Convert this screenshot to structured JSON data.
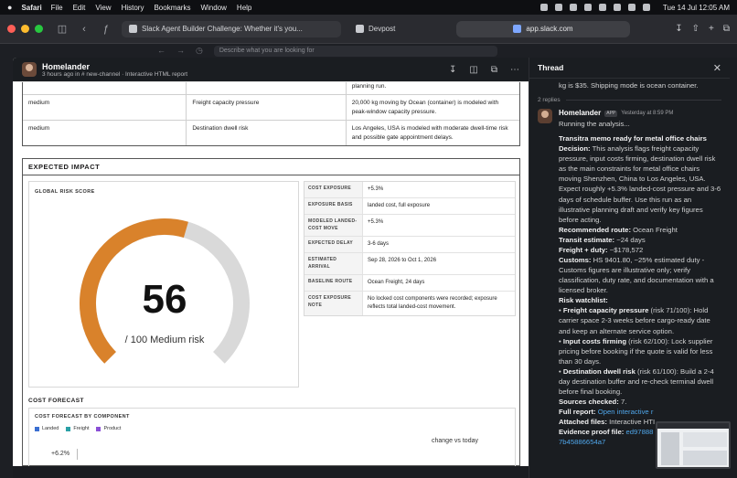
{
  "menubar": {
    "app_name": "Safari",
    "menus": [
      "File",
      "Edit",
      "View",
      "History",
      "Bookmarks",
      "Window",
      "Help"
    ],
    "clock": "Tue 14 Jul  12:05 AM"
  },
  "browser": {
    "tabs": [
      {
        "label": "Slack Agent Builder Challenge: Whether it's you..."
      },
      {
        "label": "Devpost"
      }
    ],
    "address": "app.slack.com",
    "search_placeholder": "Describe what you are looking for"
  },
  "canvas": {
    "author": "Homelander",
    "meta": "3 hours ago in # new-channel  · Interactive HTML report",
    "risk_rows": [
      {
        "level": "",
        "driver": "",
        "detail": "planning run."
      },
      {
        "level": "medium",
        "driver": "Freight capacity pressure",
        "detail": "20,000 kg moving by Ocean (container) is modeled with peak-window capacity pressure."
      },
      {
        "level": "medium",
        "driver": "Destination dwell risk",
        "detail": "Los Angeles, USA is modeled with moderate dwell-time risk and possible gate appointment delays."
      }
    ],
    "impact_title": "EXPECTED IMPACT",
    "gauge": {
      "label": "GLOBAL RISK SCORE",
      "score": "56",
      "score_value": 56,
      "max": 100,
      "caption": "/ 100 Medium risk",
      "fill_color": "#d9822b",
      "track_color": "#d9d9d9"
    },
    "exposure": [
      {
        "key": "COST EXPOSURE",
        "value": "+5.3%"
      },
      {
        "key": "EXPOSURE BASIS",
        "value": "landed cost, full exposure"
      },
      {
        "key": "MODELED LANDED-COST MOVE",
        "value": "+5.3%"
      },
      {
        "key": "EXPECTED DELAY",
        "value": "3-6 days"
      },
      {
        "key": "ESTIMATED ARRIVAL",
        "value": "Sep 28, 2026 to Oct 1, 2026"
      },
      {
        "key": "BASELINE ROUTE",
        "value": "Ocean Freight, 24 days"
      },
      {
        "key": "COST EXPOSURE NOTE",
        "value": "No locked cost components were recorded; exposure reflects total landed-cost movement."
      }
    ],
    "cost_forecast": {
      "section_title": "COST FORECAST",
      "card_title": "COST FORECAST BY COMPONENT",
      "legend": [
        {
          "name": "Landed",
          "color": "#3b6fd1"
        },
        {
          "name": "Freight",
          "color": "#2aa0a6"
        },
        {
          "name": "Product",
          "color": "#8a4fd6"
        }
      ],
      "tick": "+6.2%",
      "note": "change vs today"
    }
  },
  "thread": {
    "title": "Thread",
    "prev_text": "kg is $35. Shipping mode is ocean container.",
    "replies": "2 replies",
    "author": "Homelander",
    "badge": "APP",
    "time": "Yesterday at 8:59 PM",
    "running": "Running the analysis...",
    "memo_title": "Transitra memo ready for metal office chairs",
    "decision_label": "Decision:",
    "decision": " This analysis flags freight capacity pressure, input costs firming, destination dwell risk as the main constraints for metal office chairs moving Shenzhen, China to Los Angeles, USA. Expect roughly +5.3% landed-cost pressure and 3-6 days of schedule buffer. Use this run as an illustrative planning draft and verify key figures before acting.",
    "route_label": "Recommended route:",
    "route": " Ocean Freight",
    "transit_label": "Transit estimate:",
    "transit": " ~24 days",
    "freight_label": "Freight + duty:",
    "freight": " ~$178,572",
    "customs_label": "Customs:",
    "customs": " HS 9401.80, ~25% estimated duty - Customs figures are illustrative only; verify classification, duty rate, and documentation with a licensed broker.",
    "watchlist_label": "Risk watchlist:",
    "watch": [
      {
        "label": "Freight capacity pressure",
        "text": " (risk 71/100): Hold carrier space 2-3 weeks before cargo-ready date and keep an alternate service option."
      },
      {
        "label": "Input costs firming",
        "text": " (risk 62/100): Lock supplier pricing before booking if the quote is valid for less than 30 days."
      },
      {
        "label": "Destination dwell risk",
        "text": " (risk 61/100): Build a 2-4 day destination buffer and re-check terminal dwell before final booking."
      }
    ],
    "sources_label": "Sources checked:",
    "sources": " 7.",
    "report_label": "Full report:",
    "report_link": " Open interactive r",
    "files_label": "Attached files:",
    "files": " Interactive HTI",
    "proof_label": "Evidence proof file:",
    "proof_link": " ed97888",
    "proof_hash": "7b45886654a7"
  }
}
